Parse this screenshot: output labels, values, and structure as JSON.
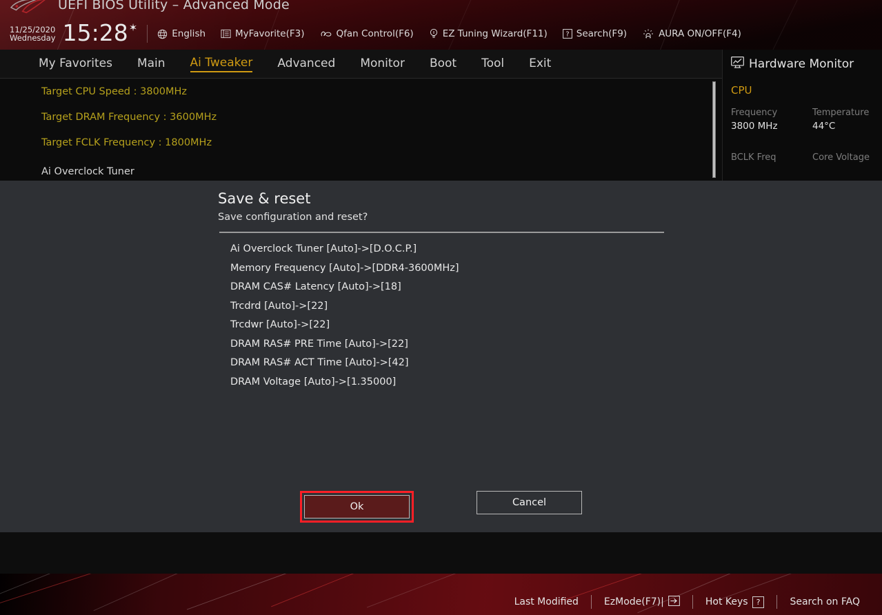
{
  "header": {
    "logo_icon": "rog-logo-icon",
    "title": "UEFI BIOS Utility – Advanced Mode",
    "date": "11/25/2020",
    "weekday": "Wednesday",
    "time": "15:28",
    "gear_icon": "gear-icon",
    "items": [
      {
        "icon": "globe-icon",
        "label": "English"
      },
      {
        "icon": "list-icon",
        "label": "MyFavorite(F3)"
      },
      {
        "icon": "fan-icon",
        "label": "Qfan Control(F6)"
      },
      {
        "icon": "bulb-icon",
        "label": "EZ Tuning Wizard(F11)"
      },
      {
        "icon": "question-box-icon",
        "label": "Search(F9)"
      },
      {
        "icon": "aura-light-icon",
        "label": "AURA ON/OFF(F4)"
      }
    ]
  },
  "tabs": [
    {
      "label": "My Favorites",
      "active": false
    },
    {
      "label": "Main",
      "active": false
    },
    {
      "label": "Ai Tweaker",
      "active": true
    },
    {
      "label": "Advanced",
      "active": false
    },
    {
      "label": "Monitor",
      "active": false
    },
    {
      "label": "Boot",
      "active": false
    },
    {
      "label": "Tool",
      "active": false
    },
    {
      "label": "Exit",
      "active": false
    }
  ],
  "content": {
    "targets": [
      "Target CPU Speed : 3800MHz",
      "Target DRAM Frequency : 3600MHz",
      "Target FCLK Frequency : 1800MHz"
    ],
    "setting_label": "Ai Overclock Tuner",
    "setting_value": "D.O.C.P.",
    "dropdown_icon": "chevron-down-icon"
  },
  "hardware_monitor": {
    "icon": "monitor-chart-icon",
    "title": "Hardware Monitor",
    "section": "CPU",
    "rows": [
      {
        "label": "Frequency",
        "value": "3800 MHz"
      },
      {
        "label": "Temperature",
        "value": "44°C"
      },
      {
        "label": "BCLK Freq",
        "value": ""
      },
      {
        "label": "Core Voltage",
        "value": ""
      }
    ],
    "labels": {
      "frequency": "Frequency",
      "temperature": "Temperature",
      "bclk": "BCLK Freq",
      "core_voltage": "Core Voltage"
    },
    "values": {
      "frequency": "3800 MHz",
      "temperature": "44°C"
    }
  },
  "dialog": {
    "title": "Save & reset",
    "subtitle": "Save configuration and reset?",
    "changes": [
      "Ai Overclock Tuner [Auto]->[D.O.C.P.]",
      "Memory Frequency [Auto]->[DDR4-3600MHz]",
      "DRAM CAS# Latency [Auto]->[18]",
      "Trcdrd [Auto]->[22]",
      "Trcdwr [Auto]->[22]",
      "DRAM RAS# PRE Time [Auto]->[22]",
      "DRAM RAS# ACT Time [Auto]->[42]",
      "DRAM Voltage [Auto]->[1.35000]"
    ],
    "ok_label": "Ok",
    "cancel_label": "Cancel",
    "focus_color": "#fc1f26"
  },
  "footer": {
    "items": [
      {
        "label": "Last Modified",
        "key": ""
      },
      {
        "label": "EzMode(F7)|",
        "key": "arrow-right-box-icon"
      },
      {
        "label": "Hot Keys",
        "key": "?"
      },
      {
        "label": "Search on FAQ",
        "key": ""
      }
    ],
    "last_modified": "Last Modified",
    "ezmode": "EzMode(F7)|",
    "hotkeys": "Hot Keys",
    "hotkeys_key": "?",
    "search_faq": "Search on FAQ"
  },
  "colors": {
    "accent_gold": "#cf9a12",
    "target_yellow": "#b5a01c",
    "modal_bg": "#2e3034",
    "focus_red": "#fc1f26",
    "ok_btn_bg": "#5a1b1b"
  }
}
